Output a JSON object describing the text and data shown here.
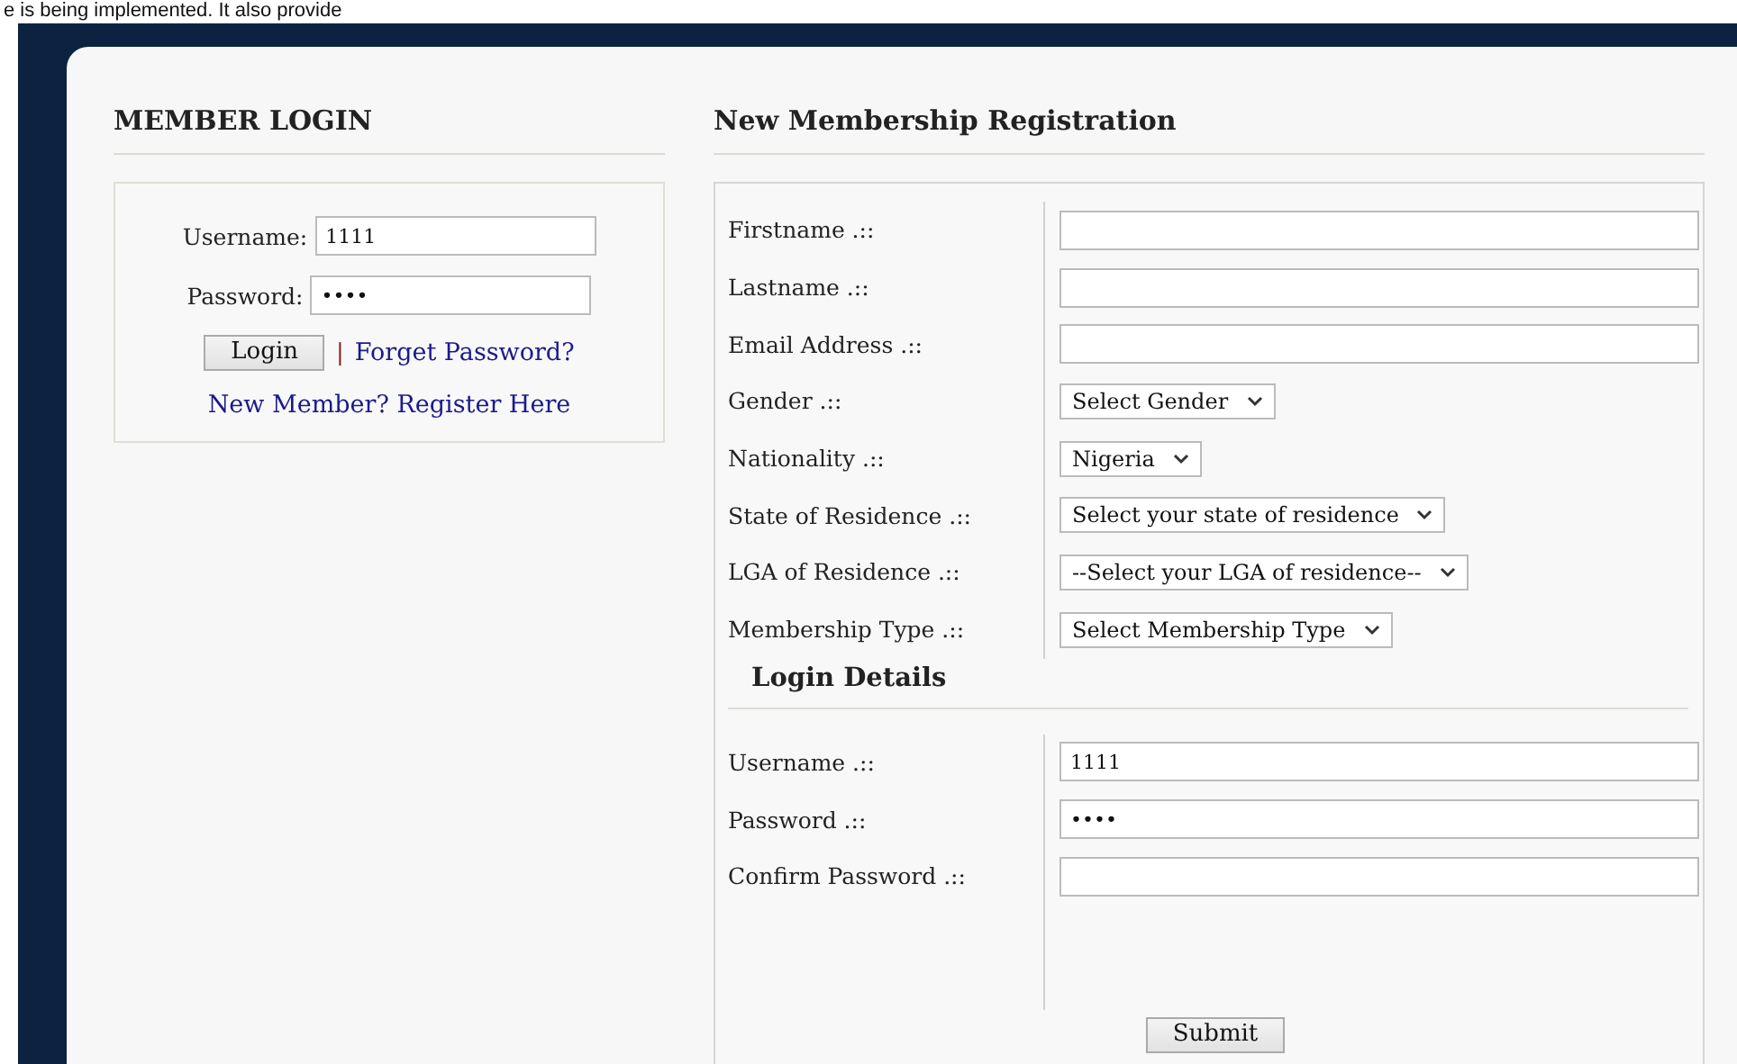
{
  "document_text": "e is being implemented. It also provide",
  "member_login": {
    "title": "MEMBER LOGIN",
    "fields": [
      {
        "label": "Username:",
        "value": "1111"
      },
      {
        "label": "Password:",
        "value": "••••"
      }
    ],
    "login_button": "Login",
    "separator": "|",
    "forgot_link": "Forget Password?",
    "register_link": "New Member? Register Here"
  },
  "registration": {
    "title": "New Membership Registration",
    "fields": [
      {
        "kind": "text",
        "label": "Firstname .::"
      },
      {
        "kind": "text",
        "label": "Lastname .::"
      },
      {
        "kind": "text",
        "label": "Email Address .::"
      },
      {
        "kind": "select",
        "label": "Gender .::",
        "value": "Select Gender"
      },
      {
        "kind": "select",
        "label": "Nationality .::",
        "value": "Nigeria"
      },
      {
        "kind": "select",
        "label": "State of Residence .::",
        "value": "Select your state of residence"
      },
      {
        "kind": "select",
        "label": "LGA of Residence .::",
        "value": "--Select your LGA of residence--"
      },
      {
        "kind": "select",
        "label": "Membership Type .::",
        "value": "Select Membership Type"
      }
    ],
    "login_details_title": "Login Details",
    "login_fields": [
      {
        "kind": "text",
        "label": "Username .::",
        "value": "1111"
      },
      {
        "kind": "text",
        "label": "Password .::",
        "value": "••••"
      },
      {
        "kind": "text",
        "label": "Confirm Password .::"
      }
    ],
    "submit_button": "Submit"
  }
}
